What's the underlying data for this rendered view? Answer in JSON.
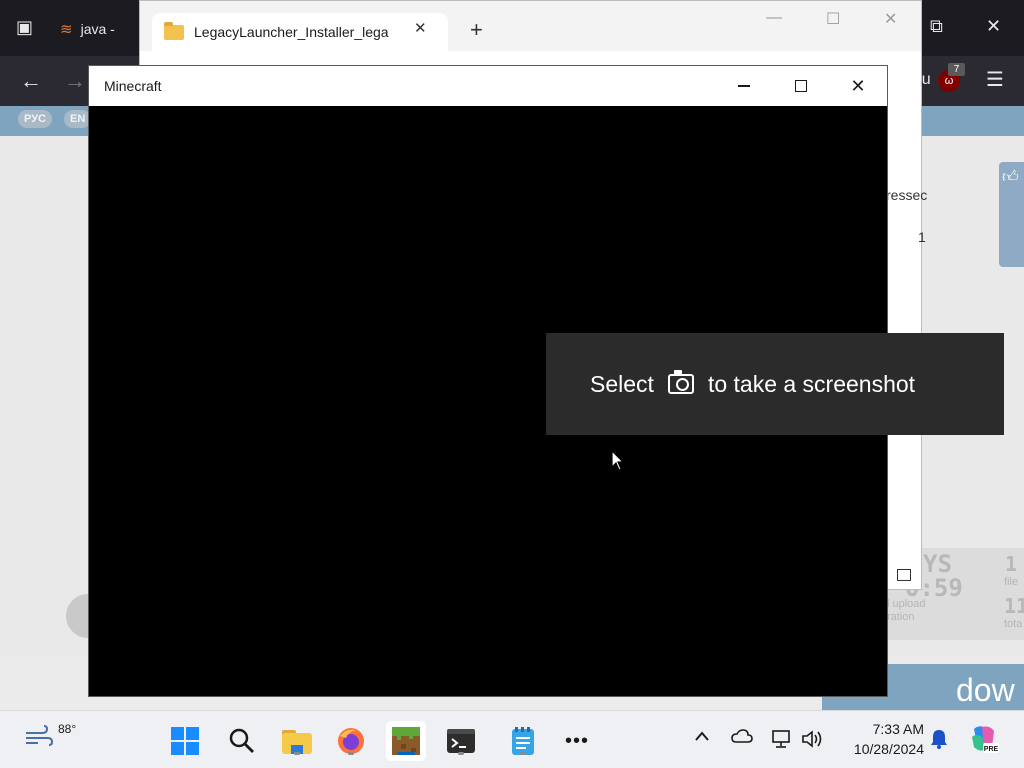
{
  "browser": {
    "tab_java_label": "java - ",
    "toolbar_partial_text": "cyLau",
    "ublock_badge_count": "7",
    "lang_pills": [
      "РУС",
      "EN"
    ],
    "page_partial_text_1": "ressec",
    "page_partial_text_2": "1",
    "stats": {
      "days_big": "YS",
      "time_big": "0:59",
      "upload_label": "l upload",
      "duration_label": "ration",
      "files_count": "1",
      "files_label": "file",
      "total_count": "11",
      "total_label": "tota"
    },
    "download_partial": "dow"
  },
  "explorer": {
    "tab_title": "LegacyLauncher_Installer_lega",
    "new_tab": "+"
  },
  "minecraft": {
    "title": "Minecraft"
  },
  "snip_toast": {
    "text_before": "Select",
    "text_after": "to take a screenshot"
  },
  "taskbar": {
    "weather_temp": "88°",
    "clock_time": "7:33 AM",
    "clock_date": "10/28/2024",
    "pinned": [
      "start",
      "search",
      "file-explorer",
      "firefox",
      "minecraft",
      "terminal",
      "notepad",
      "more"
    ]
  }
}
